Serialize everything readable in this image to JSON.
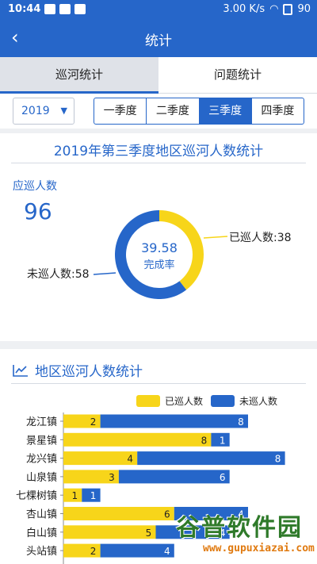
{
  "status_bar": {
    "time": "10:44",
    "network": "3.00 K/s",
    "battery": "90"
  },
  "app_bar": {
    "back_icon": "back-arrow-icon",
    "title": "统计"
  },
  "tabs": [
    {
      "label": "巡河统计",
      "active": true
    },
    {
      "label": "问题统计",
      "active": false
    }
  ],
  "filter": {
    "year": "2019",
    "quarters": [
      {
        "label": "一季度",
        "active": false
      },
      {
        "label": "二季度",
        "active": false
      },
      {
        "label": "三季度",
        "active": true
      },
      {
        "label": "四季度",
        "active": false
      }
    ]
  },
  "summary": {
    "title": "2019年第三季度地区巡河人数统计",
    "expected_label": "应巡人数",
    "expected_value": "96",
    "patrolled_label": "已巡人数:38",
    "unpatrolled_label": "未巡人数:58",
    "rate_value": "39.58",
    "rate_label": "完成率"
  },
  "region_section": {
    "title": "地区巡河人数统计",
    "icon": "trend-chart-icon"
  },
  "colors": {
    "primary": "#2666c9",
    "yellow": "#f7d51a",
    "blue": "#2666c9"
  },
  "chart_data": [
    {
      "type": "pie",
      "categories": [
        "已巡人数",
        "未巡人数"
      ],
      "values": [
        38,
        58
      ],
      "title": "2019年第三季度地区巡河人数统计"
    },
    {
      "type": "bar",
      "title": "地区巡河人数统计",
      "categories": [
        "龙江镇",
        "景星镇",
        "龙兴镇",
        "山泉镇",
        "七棵树镇",
        "杏山镇",
        "白山镇",
        "头站镇"
      ],
      "series": [
        {
          "name": "已巡人数",
          "values": [
            2,
            8,
            4,
            3,
            1,
            6,
            5,
            2
          ]
        },
        {
          "name": "未巡人数",
          "values": [
            8,
            1,
            8,
            6,
            1,
            4,
            4,
            4
          ]
        }
      ],
      "legend": "top-right"
    }
  ],
  "watermark": {
    "text": "谷普软件园",
    "url": "www.gupuxiazai.com"
  }
}
